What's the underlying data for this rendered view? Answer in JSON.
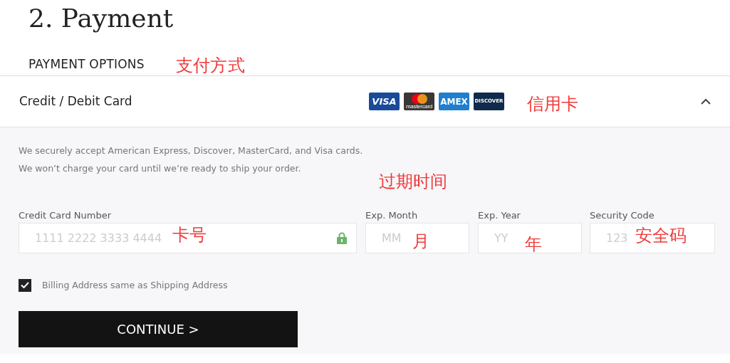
{
  "heading": "2. Payment",
  "section_label": "PAYMENT OPTIONS",
  "section_annotation": "支付方式",
  "payment_method": {
    "title": "Credit / Debit Card",
    "expanded": true,
    "annotation": "信用卡",
    "card_brands": [
      {
        "kind": "visa",
        "label": "VISA"
      },
      {
        "kind": "mastercard",
        "label": "mastercard"
      },
      {
        "kind": "amex",
        "label": "AMEX"
      },
      {
        "kind": "discover",
        "label": "DISCOVER"
      }
    ]
  },
  "notes": [
    "We securely accept American Express, Discover, MasterCard, and Visa cards.",
    "We won’t charge your card until we’re ready to ship your order."
  ],
  "expiry_annotation": "过期时间",
  "fields": [
    {
      "kind": "card",
      "label": "Credit Card Number",
      "placeholder": "1111 2222 3333 4444",
      "annotation": "卡号",
      "secure": true
    },
    {
      "kind": "month",
      "label": "Exp. Month",
      "placeholder": "MM",
      "annotation": "月"
    },
    {
      "kind": "year",
      "label": "Exp. Year",
      "placeholder": "YY",
      "annotation": "年"
    },
    {
      "kind": "cvv",
      "label": "Security Code",
      "placeholder": "123",
      "annotation": "安全码"
    }
  ],
  "billing_same": {
    "label": "Billing Address same as Shipping Address",
    "checked": true
  },
  "continue_button": "CONTINUE >"
}
